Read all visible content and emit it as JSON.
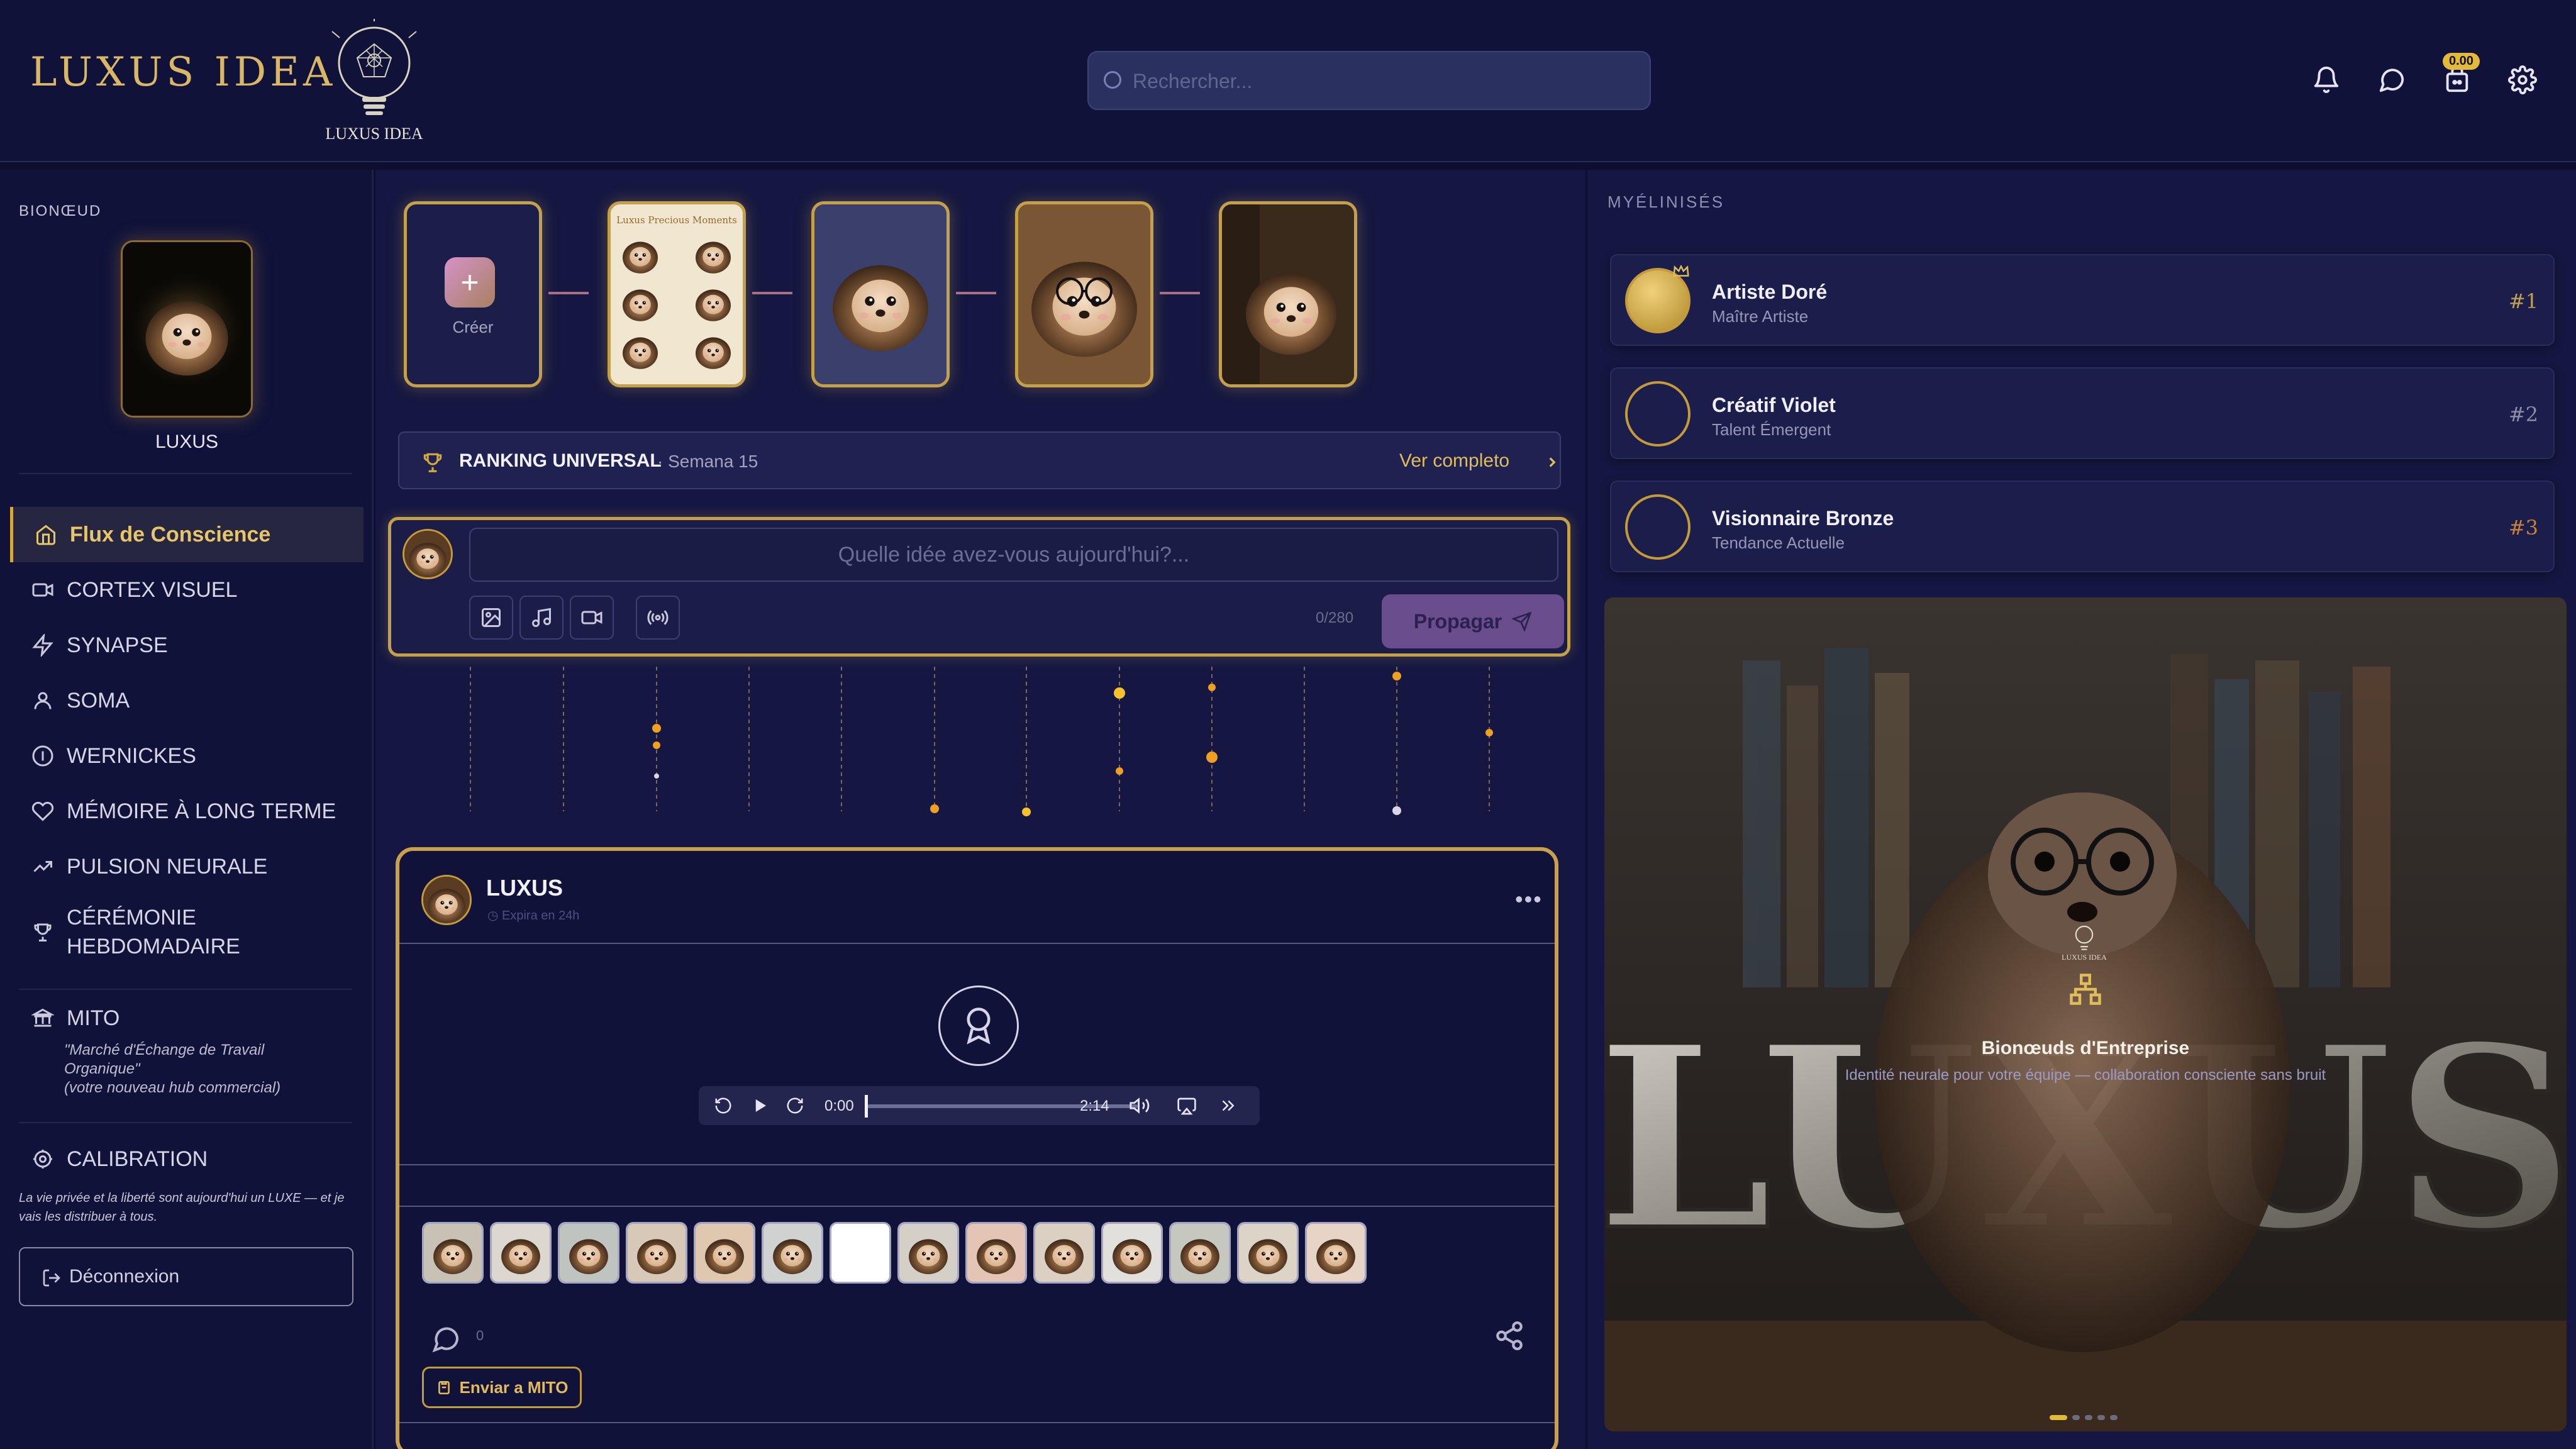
{
  "header": {
    "brand": "LUXUS IDEA",
    "logo_caption": "LUXUS IDEA",
    "search_placeholder": "Rechercher...",
    "cart_badge": "0.00",
    "icons": [
      "bell-icon",
      "chat-icon",
      "cart-icon",
      "gear-icon"
    ]
  },
  "sidebar": {
    "profile_label": "BIONŒUD",
    "profile_name": "LUXUS",
    "nav": [
      {
        "label": "Flux de Conscience",
        "icon": "home-icon",
        "active": true
      },
      {
        "label": "CORTEX VISUEL",
        "icon": "video-icon"
      },
      {
        "label": "SYNAPSE",
        "icon": "bolt-icon"
      },
      {
        "label": "SOMA",
        "icon": "user-icon"
      },
      {
        "label": "WERNICKES",
        "icon": "info-icon"
      },
      {
        "label": "MÉMOIRE À LONG TERME",
        "icon": "heart-icon"
      },
      {
        "label": "PULSION NEURALE",
        "icon": "trend-icon"
      },
      {
        "label": "CÉRÉMONIE HEBDOMADAIRE",
        "icon": "trophy-icon"
      }
    ],
    "mito": {
      "label": "MITO",
      "line1": "\"Marché d'Échange de Travail",
      "line2": "Organique\"",
      "line3": "(votre nouveau hub commercial)"
    },
    "calibration": "CALIBRATION",
    "footnote": "La vie privée et la liberté sont aujourd'hui un LUXE — et je vais les distribuer à tous.",
    "logout": "Déconnexion"
  },
  "stories": {
    "create_label": "Créer",
    "story3_banner": "Luxus Precious Moments"
  },
  "ranking": {
    "title": "RANKING UNIVERSAL",
    "week": "· Semana 15",
    "link": "Ver completo"
  },
  "composer": {
    "placeholder": "Quelle idée avez-vous aujourd'hui?...",
    "counter": "0/280",
    "button": "Propagar"
  },
  "post": {
    "author": "LUXUS",
    "expires": "Expira en 24h",
    "audio": {
      "current": "0:00",
      "duration": "2:14",
      "progress": 0
    },
    "comment_count": "0",
    "send_button": "Enviar a MITO"
  },
  "right": {
    "title": "MYÉLINISÉS",
    "ranks": [
      {
        "name": "Artiste Doré",
        "subtitle": "Maître Artiste",
        "rank": "#1"
      },
      {
        "name": "Créatif Violet",
        "subtitle": "Talent Émergent",
        "rank": "#2"
      },
      {
        "name": "Visionnaire Bronze",
        "subtitle": "Tendance Actuelle",
        "rank": "#3"
      }
    ],
    "banner": {
      "logo_caption": "LUXUS IDEA",
      "big_text": "LUXUS",
      "title": "Bionœuds d'Entreprise",
      "subtitle": "Identité neurale pour votre équipe — collaboration consciente sans bruit",
      "slides": 5,
      "active_slide": 1
    }
  },
  "colors": {
    "background": "#0e0f2e",
    "panel": "#151742",
    "accent_gold": "#c9a14c",
    "active_text": "#e6c56b",
    "button_purple": "#6a4d8c"
  }
}
